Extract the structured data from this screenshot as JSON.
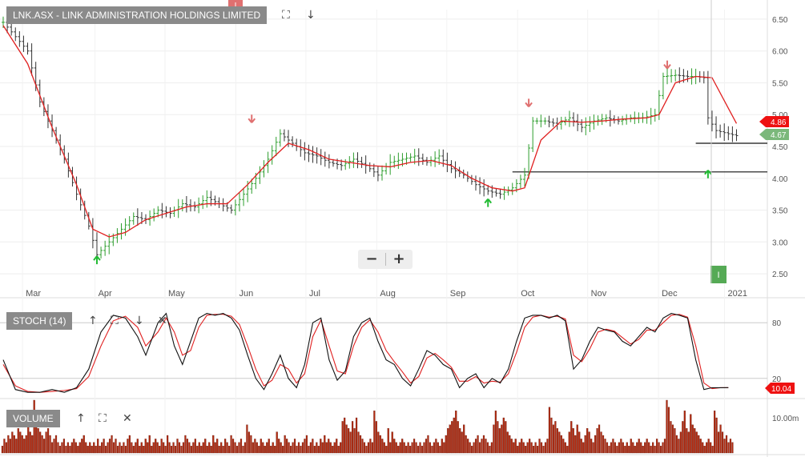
{
  "main_panel": {
    "title": "LNK.ASX - LINK ADMINISTRATION HOLDINGS LIMITED",
    "expand_icon": "expand-icon",
    "down_icon": "arrow-down-icon",
    "zoom_out_label": "−",
    "zoom_in_label": "+"
  },
  "stoch_panel": {
    "title": "STOCH (14)",
    "icons": [
      "arrow-up-icon",
      "expand-icon",
      "arrow-down-icon",
      "close-icon"
    ]
  },
  "volume_panel": {
    "title": "VOLUME",
    "icons": [
      "arrow-up-icon",
      "expand-icon",
      "close-icon"
    ]
  },
  "colors": {
    "up_bar": "#2e9e2e",
    "down_bar": "#333333",
    "ma_line": "#e02020",
    "stoch_k": "#111111",
    "stoch_d": "#e02020",
    "volume": "#b42a10",
    "up_arrow": "#22bb33",
    "down_arrow": "#e07070",
    "last_price_badge": "#7bb87b",
    "ma_badge": "#ee1111",
    "tag_bg": "#8a8a8a"
  },
  "chart_data": [
    {
      "type": "ohlc",
      "x_months": [
        "Mar",
        "Apr",
        "May",
        "Jun",
        "Jul",
        "Aug",
        "Sep",
        "Oct",
        "Nov",
        "Dec",
        "2021"
      ],
      "y_ticks": [
        "2.50",
        "3.00",
        "3.50",
        "4.00",
        "4.50",
        "5.00",
        "5.50",
        "6.00",
        "6.50"
      ],
      "ylim": [
        2.35,
        6.65
      ],
      "grid": true,
      "moving_average_value": "4.86",
      "last_price_label": "4.67",
      "support_lines": [
        4.55,
        4.1
      ],
      "price_path": [
        [
          0,
          6.45
        ],
        [
          6,
          6.0
        ],
        [
          9,
          5.2
        ],
        [
          12,
          4.75
        ],
        [
          15,
          4.3
        ],
        [
          18,
          3.75
        ],
        [
          21,
          3.25
        ],
        [
          23,
          2.8
        ],
        [
          26,
          3.0
        ],
        [
          29,
          3.2
        ],
        [
          32,
          3.4
        ],
        [
          35,
          3.35
        ],
        [
          38,
          3.5
        ],
        [
          41,
          3.45
        ],
        [
          44,
          3.6
        ],
        [
          47,
          3.55
        ],
        [
          50,
          3.7
        ],
        [
          53,
          3.6
        ],
        [
          56,
          3.5
        ],
        [
          59,
          3.75
        ],
        [
          62,
          4.0
        ],
        [
          65,
          4.3
        ],
        [
          68,
          4.7
        ],
        [
          71,
          4.55
        ],
        [
          74,
          4.4
        ],
        [
          77,
          4.35
        ],
        [
          80,
          4.25
        ],
        [
          83,
          4.2
        ],
        [
          86,
          4.3
        ],
        [
          89,
          4.2
        ],
        [
          92,
          4.05
        ],
        [
          95,
          4.25
        ],
        [
          98,
          4.3
        ],
        [
          101,
          4.35
        ],
        [
          104,
          4.25
        ],
        [
          107,
          4.35
        ],
        [
          110,
          4.15
        ],
        [
          113,
          4.05
        ],
        [
          116,
          3.9
        ],
        [
          119,
          3.8
        ],
        [
          122,
          3.75
        ],
        [
          125,
          3.85
        ],
        [
          128,
          4.05
        ],
        [
          130,
          4.9
        ],
        [
          133,
          4.9
        ],
        [
          136,
          4.85
        ],
        [
          139,
          4.95
        ],
        [
          142,
          4.8
        ],
        [
          145,
          4.9
        ],
        [
          148,
          4.95
        ],
        [
          151,
          4.9
        ],
        [
          154,
          4.95
        ],
        [
          157,
          4.95
        ],
        [
          160,
          5.0
        ],
        [
          162,
          5.6
        ],
        [
          165,
          5.62
        ],
        [
          168,
          5.6
        ],
        [
          170,
          5.6
        ],
        [
          172,
          5.58
        ],
        [
          173,
          4.95
        ],
        [
          175,
          4.75
        ],
        [
          178,
          4.7
        ],
        [
          180,
          4.67
        ]
      ],
      "ma_path": [
        [
          0,
          6.4
        ],
        [
          6,
          5.8
        ],
        [
          12,
          4.8
        ],
        [
          18,
          3.9
        ],
        [
          22,
          3.2
        ],
        [
          26,
          3.08
        ],
        [
          30,
          3.15
        ],
        [
          35,
          3.35
        ],
        [
          40,
          3.45
        ],
        [
          45,
          3.55
        ],
        [
          50,
          3.6
        ],
        [
          55,
          3.6
        ],
        [
          60,
          3.9
        ],
        [
          65,
          4.25
        ],
        [
          70,
          4.55
        ],
        [
          75,
          4.45
        ],
        [
          80,
          4.3
        ],
        [
          85,
          4.25
        ],
        [
          90,
          4.2
        ],
        [
          95,
          4.18
        ],
        [
          100,
          4.25
        ],
        [
          105,
          4.28
        ],
        [
          110,
          4.2
        ],
        [
          115,
          4.0
        ],
        [
          120,
          3.85
        ],
        [
          125,
          3.8
        ],
        [
          128,
          3.85
        ],
        [
          132,
          4.6
        ],
        [
          137,
          4.9
        ],
        [
          142,
          4.88
        ],
        [
          147,
          4.9
        ],
        [
          152,
          4.93
        ],
        [
          158,
          4.95
        ],
        [
          161,
          5.0
        ],
        [
          165,
          5.5
        ],
        [
          170,
          5.6
        ],
        [
          174,
          5.58
        ],
        [
          180,
          4.86
        ]
      ],
      "buy_signals": [
        [
          23,
          2.7
        ],
        [
          119,
          3.6
        ],
        [
          173,
          4.05
        ]
      ],
      "sell_signals": [
        [
          61,
          4.95
        ],
        [
          129,
          5.2
        ],
        [
          163,
          5.8
        ]
      ]
    },
    {
      "type": "line",
      "title": "STOCH (14)",
      "y_ticks": [
        "20",
        "80"
      ],
      "ylim": [
        0,
        100
      ],
      "last_value_label": "10.04",
      "k_path": [
        [
          0,
          40
        ],
        [
          3,
          8
        ],
        [
          6,
          5
        ],
        [
          9,
          5
        ],
        [
          12,
          8
        ],
        [
          15,
          5
        ],
        [
          18,
          10
        ],
        [
          21,
          30
        ],
        [
          24,
          70
        ],
        [
          27,
          88
        ],
        [
          30,
          85
        ],
        [
          33,
          65
        ],
        [
          35,
          45
        ],
        [
          38,
          80
        ],
        [
          40,
          90
        ],
        [
          42,
          55
        ],
        [
          44,
          35
        ],
        [
          46,
          60
        ],
        [
          48,
          85
        ],
        [
          50,
          90
        ],
        [
          52,
          88
        ],
        [
          54,
          90
        ],
        [
          56,
          85
        ],
        [
          58,
          72
        ],
        [
          60,
          45
        ],
        [
          62,
          20
        ],
        [
          64,
          8
        ],
        [
          66,
          25
        ],
        [
          68,
          45
        ],
        [
          70,
          20
        ],
        [
          72,
          10
        ],
        [
          74,
          35
        ],
        [
          76,
          80
        ],
        [
          78,
          85
        ],
        [
          80,
          40
        ],
        [
          82,
          18
        ],
        [
          84,
          28
        ],
        [
          86,
          65
        ],
        [
          88,
          80
        ],
        [
          90,
          85
        ],
        [
          92,
          60
        ],
        [
          94,
          40
        ],
        [
          96,
          35
        ],
        [
          98,
          20
        ],
        [
          100,
          12
        ],
        [
          102,
          30
        ],
        [
          104,
          50
        ],
        [
          106,
          45
        ],
        [
          108,
          35
        ],
        [
          110,
          30
        ],
        [
          112,
          10
        ],
        [
          114,
          20
        ],
        [
          116,
          25
        ],
        [
          118,
          10
        ],
        [
          120,
          20
        ],
        [
          122,
          15
        ],
        [
          124,
          30
        ],
        [
          126,
          60
        ],
        [
          128,
          85
        ],
        [
          130,
          88
        ],
        [
          132,
          88
        ],
        [
          134,
          85
        ],
        [
          136,
          88
        ],
        [
          138,
          82
        ],
        [
          140,
          30
        ],
        [
          142,
          40
        ],
        [
          144,
          60
        ],
        [
          146,
          75
        ],
        [
          148,
          72
        ],
        [
          150,
          70
        ],
        [
          152,
          60
        ],
        [
          154,
          55
        ],
        [
          156,
          65
        ],
        [
          158,
          75
        ],
        [
          160,
          70
        ],
        [
          162,
          85
        ],
        [
          164,
          90
        ],
        [
          166,
          88
        ],
        [
          168,
          85
        ],
        [
          170,
          40
        ],
        [
          172,
          8
        ],
        [
          174,
          10
        ],
        [
          176,
          10
        ],
        [
          178,
          10.04
        ]
      ],
      "d_path": [
        [
          0,
          35
        ],
        [
          3,
          12
        ],
        [
          6,
          6
        ],
        [
          9,
          5
        ],
        [
          12,
          6
        ],
        [
          15,
          7
        ],
        [
          18,
          9
        ],
        [
          21,
          22
        ],
        [
          24,
          55
        ],
        [
          27,
          82
        ],
        [
          30,
          87
        ],
        [
          33,
          75
        ],
        [
          35,
          55
        ],
        [
          38,
          70
        ],
        [
          40,
          85
        ],
        [
          42,
          70
        ],
        [
          44,
          45
        ],
        [
          46,
          50
        ],
        [
          48,
          75
        ],
        [
          50,
          88
        ],
        [
          52,
          89
        ],
        [
          54,
          89
        ],
        [
          56,
          87
        ],
        [
          58,
          78
        ],
        [
          60,
          55
        ],
        [
          62,
          30
        ],
        [
          64,
          12
        ],
        [
          66,
          18
        ],
        [
          68,
          35
        ],
        [
          70,
          30
        ],
        [
          72,
          15
        ],
        [
          74,
          25
        ],
        [
          76,
          65
        ],
        [
          78,
          83
        ],
        [
          80,
          55
        ],
        [
          82,
          28
        ],
        [
          84,
          25
        ],
        [
          86,
          55
        ],
        [
          88,
          75
        ],
        [
          90,
          83
        ],
        [
          92,
          70
        ],
        [
          94,
          50
        ],
        [
          96,
          38
        ],
        [
          98,
          27
        ],
        [
          100,
          15
        ],
        [
          102,
          22
        ],
        [
          104,
          42
        ],
        [
          106,
          47
        ],
        [
          108,
          40
        ],
        [
          110,
          32
        ],
        [
          112,
          17
        ],
        [
          114,
          17
        ],
        [
          116,
          22
        ],
        [
          118,
          15
        ],
        [
          120,
          17
        ],
        [
          122,
          16
        ],
        [
          124,
          25
        ],
        [
          126,
          48
        ],
        [
          128,
          75
        ],
        [
          130,
          86
        ],
        [
          132,
          88
        ],
        [
          134,
          86
        ],
        [
          136,
          87
        ],
        [
          138,
          84
        ],
        [
          140,
          45
        ],
        [
          142,
          38
        ],
        [
          144,
          52
        ],
        [
          146,
          70
        ],
        [
          148,
          73
        ],
        [
          150,
          71
        ],
        [
          152,
          64
        ],
        [
          154,
          57
        ],
        [
          156,
          62
        ],
        [
          158,
          72
        ],
        [
          160,
          72
        ],
        [
          162,
          80
        ],
        [
          164,
          88
        ],
        [
          166,
          89
        ],
        [
          168,
          86
        ],
        [
          170,
          55
        ],
        [
          172,
          15
        ],
        [
          174,
          9
        ],
        [
          176,
          10
        ],
        [
          178,
          10
        ]
      ]
    },
    {
      "type": "bar",
      "title": "VOLUME",
      "y_ticks": [
        "10.00m"
      ],
      "ylim": [
        0,
        15
      ],
      "values": [
        2,
        4,
        3,
        5,
        4,
        6,
        5,
        4,
        7,
        6,
        5,
        4,
        5,
        8,
        6,
        5,
        15,
        9,
        7,
        6,
        5,
        4,
        6,
        7,
        5,
        3,
        4,
        5,
        3,
        2,
        3,
        4,
        2,
        3,
        2,
        3,
        4,
        3,
        2,
        3,
        4,
        5,
        3,
        2,
        3,
        2,
        3,
        2,
        4,
        2,
        3,
        4,
        2,
        3,
        4,
        5,
        3,
        4,
        2,
        3,
        2,
        3,
        2,
        4,
        5,
        3,
        2,
        3,
        4,
        2,
        3,
        2,
        4,
        3,
        5,
        2,
        3,
        4,
        3,
        2,
        4,
        3,
        2,
        5,
        3,
        2,
        3,
        2,
        4,
        3,
        2,
        3,
        5,
        4,
        3,
        2,
        3,
        4,
        2,
        3,
        2,
        3,
        4,
        2,
        3,
        2,
        5,
        3,
        4,
        2,
        3,
        2,
        4,
        3,
        2,
        5,
        4,
        3,
        2,
        3,
        4,
        2,
        3,
        8,
        6,
        5,
        3,
        4,
        3,
        2,
        4,
        3,
        2,
        3,
        4,
        2,
        3,
        2,
        6,
        4,
        3,
        2,
        5,
        4,
        3,
        2,
        3,
        4,
        2,
        3,
        2,
        3,
        4,
        5,
        2,
        3,
        4,
        2,
        3,
        2,
        4,
        3,
        5,
        3,
        4,
        3,
        2,
        3,
        4,
        2,
        3,
        9,
        10,
        8,
        7,
        6,
        9,
        7,
        10,
        6,
        5,
        4,
        3,
        2,
        3,
        4,
        3,
        12,
        9,
        6,
        5,
        4,
        3,
        2,
        7,
        3,
        6,
        4,
        3,
        2,
        3,
        4,
        3,
        2,
        3,
        2,
        3,
        4,
        3,
        2,
        3,
        2,
        3,
        4,
        5,
        3,
        2,
        3,
        4,
        3,
        2,
        4,
        3,
        5,
        7,
        8,
        9,
        10,
        12,
        9,
        7,
        6,
        8,
        5,
        4,
        3,
        2,
        3,
        4,
        5,
        3,
        4,
        5,
        4,
        3,
        2,
        3,
        8,
        12,
        9,
        7,
        8,
        10,
        9,
        6,
        5,
        4,
        3,
        4,
        2,
        3,
        4,
        3,
        2,
        3,
        4,
        3,
        2,
        3,
        2,
        4,
        3,
        2,
        3,
        4,
        13,
        10,
        8,
        9,
        7,
        6,
        5,
        4,
        3,
        2,
        6,
        9,
        7,
        5,
        8,
        6,
        4,
        3,
        5,
        7,
        6,
        4,
        3,
        5,
        7,
        8,
        6,
        5,
        4,
        3,
        2,
        3,
        4,
        3,
        2,
        3,
        4,
        3,
        2,
        3,
        2,
        4,
        3,
        2,
        3,
        4,
        3,
        2,
        3,
        4,
        3,
        2,
        3,
        2,
        4,
        3,
        2,
        3,
        4,
        15,
        13,
        9,
        8,
        7,
        5,
        4,
        6,
        9,
        12,
        7,
        6,
        11,
        8,
        7,
        6,
        5,
        4,
        3,
        2,
        3,
        4,
        3,
        2,
        12,
        10,
        6,
        8,
        6,
        4,
        5,
        3,
        4,
        3
      ]
    }
  ]
}
